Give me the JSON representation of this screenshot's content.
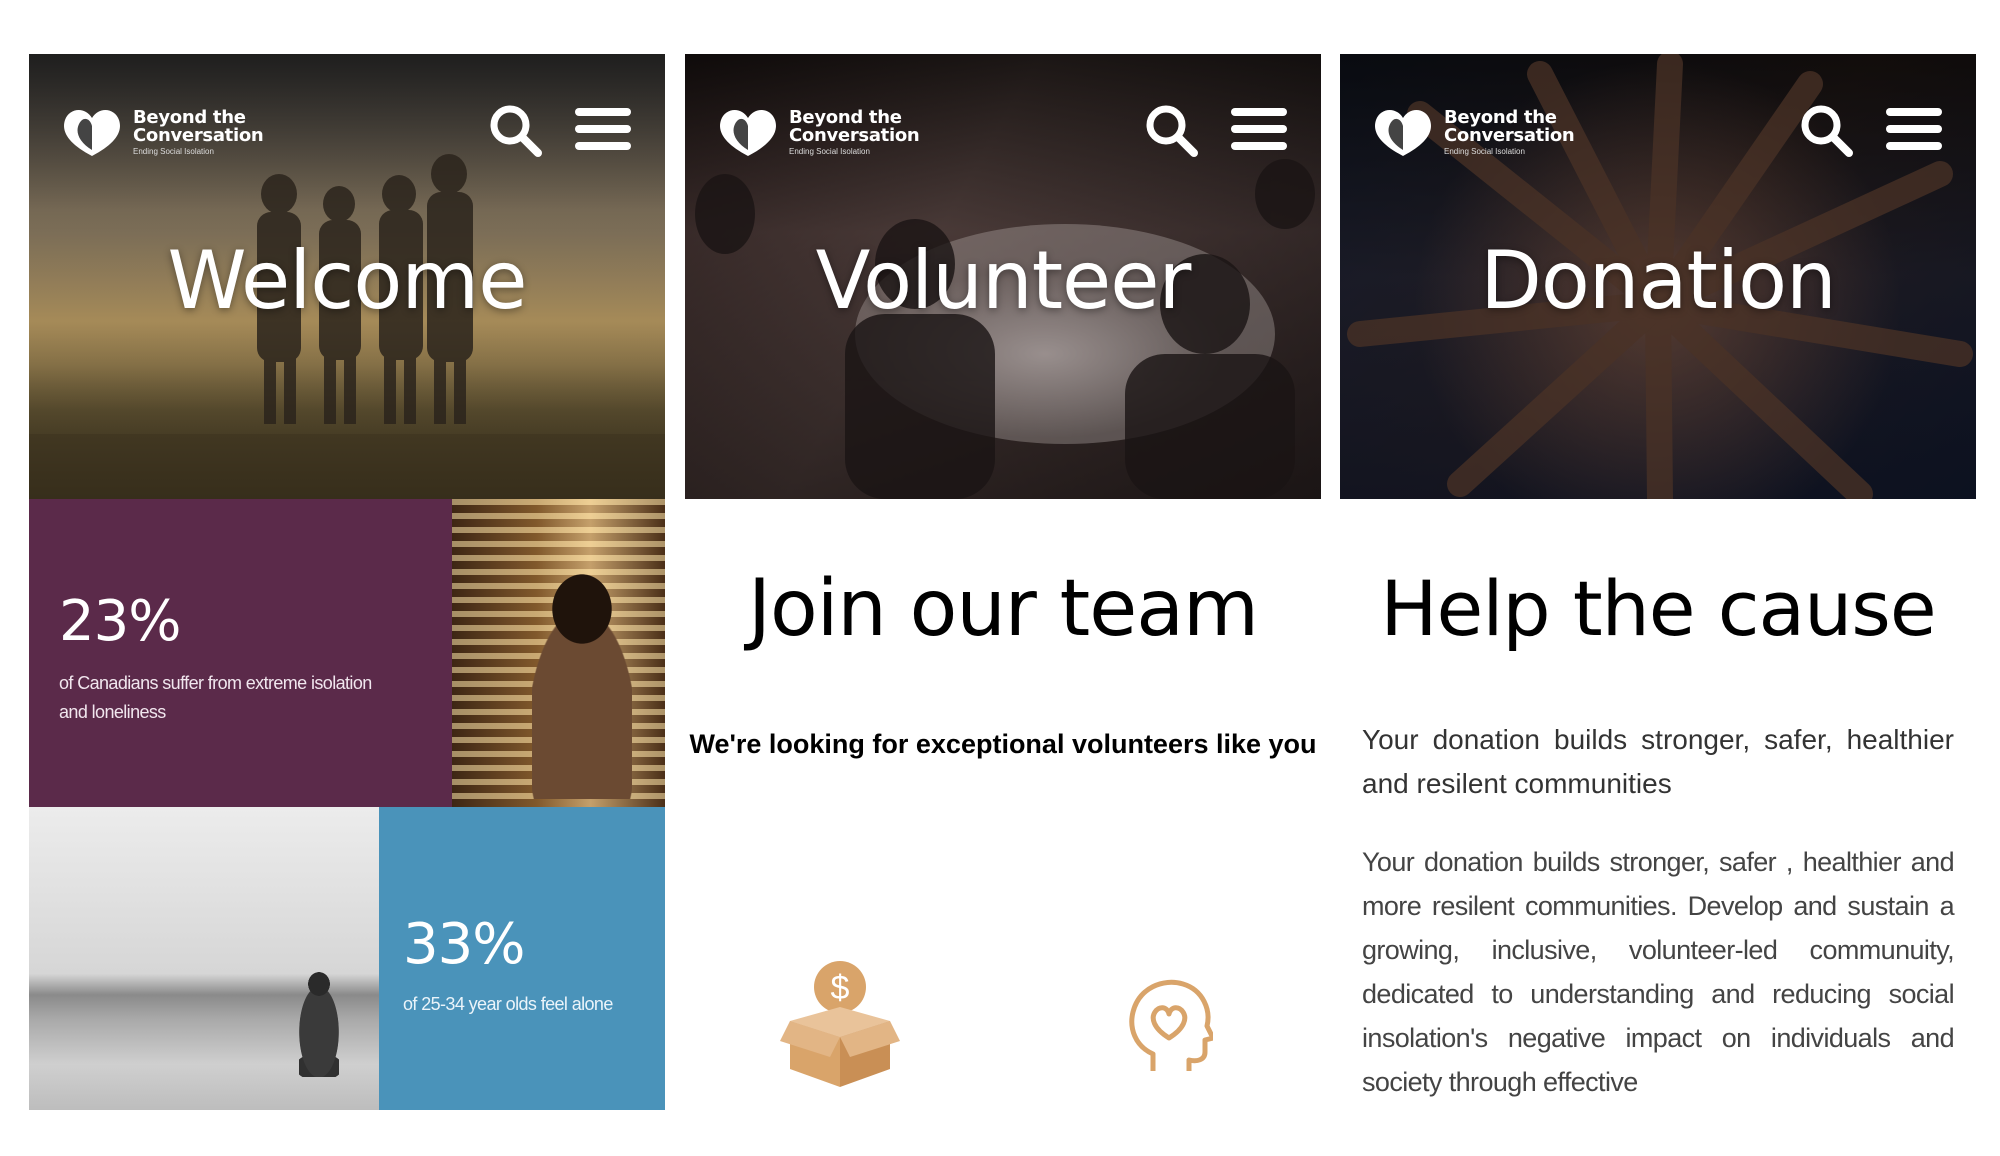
{
  "brand": {
    "name_line1": "Beyond the",
    "name_line2": "Conversation",
    "tagline": "Ending Social Isolation"
  },
  "icons": {
    "search": "search-icon",
    "menu": "hamburger-menu-icon",
    "logo": "heart-logo-icon",
    "donation_box": "money-box-icon",
    "head_heart": "head-heart-icon"
  },
  "colors": {
    "purple": "#5b2a4a",
    "blue": "#4a93ba",
    "accent_tan": "#d9a46a"
  },
  "panels": {
    "welcome": {
      "hero_title": "Welcome",
      "stat1": {
        "value": "23%",
        "description": "of Canadians suffer from extreme isolation and loneliness"
      },
      "stat2": {
        "value": "33%",
        "description": "of 25-34 year olds feel alone"
      }
    },
    "volunteer": {
      "hero_title": "Volunteer",
      "heading": "Join our team",
      "subheading": "We're looking for exceptional volunteers like you"
    },
    "donation": {
      "hero_title": "Donation",
      "heading": "Help the cause",
      "lead": "Your donation builds stronger, safer, healthier and resilent communities",
      "body": "Your donation builds stronger, safer , healthier and more resilent communities. Develop and sustain a growing, inclusive, volunteer-led communuity, dedicated to understanding and reducing social insolation's negative impact on individuals and society through effective"
    }
  }
}
